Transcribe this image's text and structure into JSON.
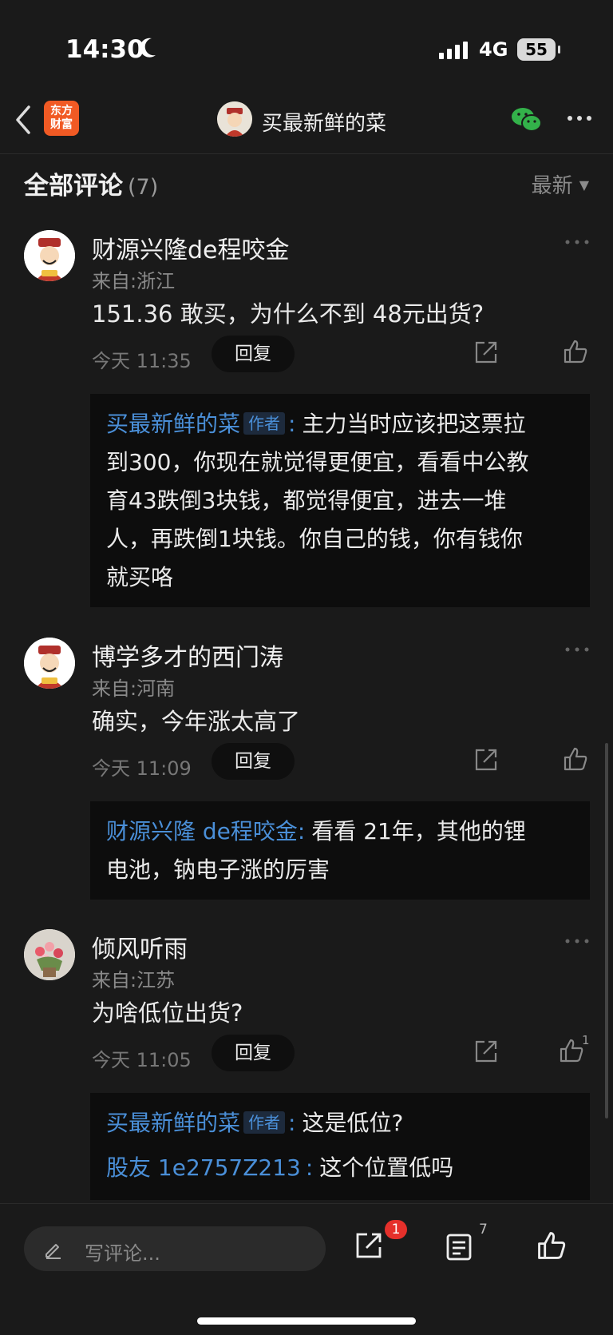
{
  "status": {
    "time": "14:30",
    "network": "4G",
    "battery": "55"
  },
  "nav": {
    "brand_line1": "东方",
    "brand_line2": "财富",
    "title": "买最新鲜的菜"
  },
  "section": {
    "title": "全部评论",
    "count": "(7)",
    "sort": "最新"
  },
  "comments": [
    {
      "name": "财源兴隆de程咬金",
      "location": "来自:浙江",
      "text": "151.36 敢买，为什么不到 48元出货?",
      "time": "今天 11:35",
      "reply_label": "回复",
      "likes": "",
      "replies": [
        {
          "name": "买最新鲜的菜",
          "tag": "作者",
          "lines": [
            "主力当时应该把这票拉",
            "到300，你现在就觉得更便宜，看看中公教",
            "育43跌倒3块钱，都觉得便宜，进去一堆",
            "人，再跌倒1块钱。你自己的钱，你有钱你",
            "就买咯"
          ]
        }
      ]
    },
    {
      "name": "博学多才的西门涛",
      "location": "来自:河南",
      "text": "确实，今年涨太高了",
      "time": "今天 11:09",
      "reply_label": "回复",
      "likes": "",
      "replies": [
        {
          "name": "财源兴隆 de程咬金",
          "tag": "",
          "lines": [
            "看看 21年，其他的锂",
            "电池，钠电子涨的厉害"
          ]
        }
      ]
    },
    {
      "name": "倾风听雨",
      "location": "来自:江苏",
      "text": "为啥低位出货?",
      "time": "今天 11:05",
      "reply_label": "回复",
      "likes": "1",
      "replies": [
        {
          "name": "买最新鲜的菜",
          "tag": "作者",
          "lines": [
            "这是低位?"
          ]
        },
        {
          "name": "股友 1e2757Z213",
          "tag": "",
          "lines": [
            "这个位置低吗"
          ]
        }
      ]
    }
  ],
  "bottom": {
    "placeholder": "写评论...",
    "share_badge": "1",
    "comment_count": "7"
  },
  "colors": {
    "accent_blue": "#4a8fd8",
    "brand_orange": "#f15a24",
    "badge_red": "#e5302b",
    "background": "#1a1a1a"
  }
}
